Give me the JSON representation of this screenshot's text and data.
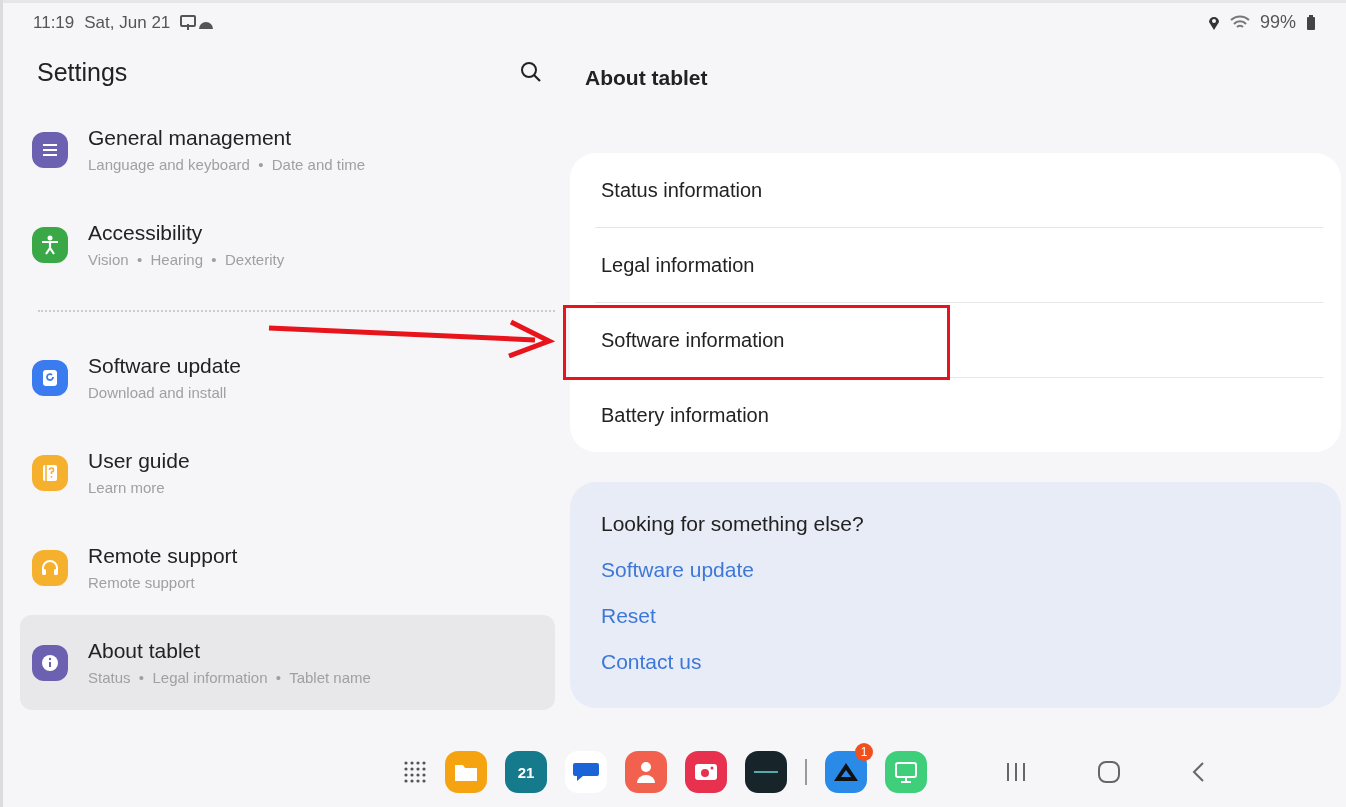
{
  "status_bar": {
    "time": "11:19",
    "date": "Sat, Jun 21",
    "battery": "99%"
  },
  "settings": {
    "title": "Settings",
    "groups": [
      [
        {
          "kind": "sliders",
          "color": "#6b61b0",
          "title": "General management",
          "subtitle": "Language and keyboard  •  Date and time",
          "selected": false
        },
        {
          "kind": "person",
          "color": "#3aa846",
          "title": "Accessibility",
          "subtitle": "Vision  •  Hearing  •  Dexterity",
          "selected": false
        }
      ],
      [
        {
          "kind": "update",
          "color": "#3a7bf0",
          "title": "Software update",
          "subtitle": "Download and install",
          "selected": false
        },
        {
          "kind": "guide",
          "color": "#f5b02e",
          "title": "User guide",
          "subtitle": "Learn more",
          "selected": false
        },
        {
          "kind": "headset",
          "color": "#f5b02e",
          "title": "Remote support",
          "subtitle": "Remote support",
          "selected": false
        },
        {
          "kind": "info",
          "color": "#6b61b0",
          "title": "About tablet",
          "subtitle": "Status  •  Legal information  •  Tablet name",
          "selected": true
        }
      ]
    ]
  },
  "about": {
    "title": "About tablet",
    "items": [
      {
        "label": "Status information",
        "highlighted": false
      },
      {
        "label": "Legal information",
        "highlighted": false
      },
      {
        "label": "Software information",
        "highlighted": true
      },
      {
        "label": "Battery information",
        "highlighted": false
      }
    ]
  },
  "suggestions": {
    "title": "Looking for something else?",
    "links": [
      "Software update",
      "Reset",
      "Contact us"
    ]
  },
  "dock": {
    "apps": [
      {
        "kind": "folder",
        "color": "#f6a312"
      },
      {
        "kind": "calendar",
        "color": "#157a8c",
        "label": "21"
      },
      {
        "kind": "chat",
        "color": "#ffffff"
      },
      {
        "kind": "contact",
        "color": "#f2614d"
      },
      {
        "kind": "camera",
        "color": "#e8304f"
      },
      {
        "kind": "dark",
        "color": "#17252b"
      },
      {
        "kind": "divider"
      },
      {
        "kind": "mountain",
        "color": "#2a8ae8",
        "badge": "1"
      },
      {
        "kind": "monitor",
        "color": "#3fcf7a"
      }
    ]
  }
}
